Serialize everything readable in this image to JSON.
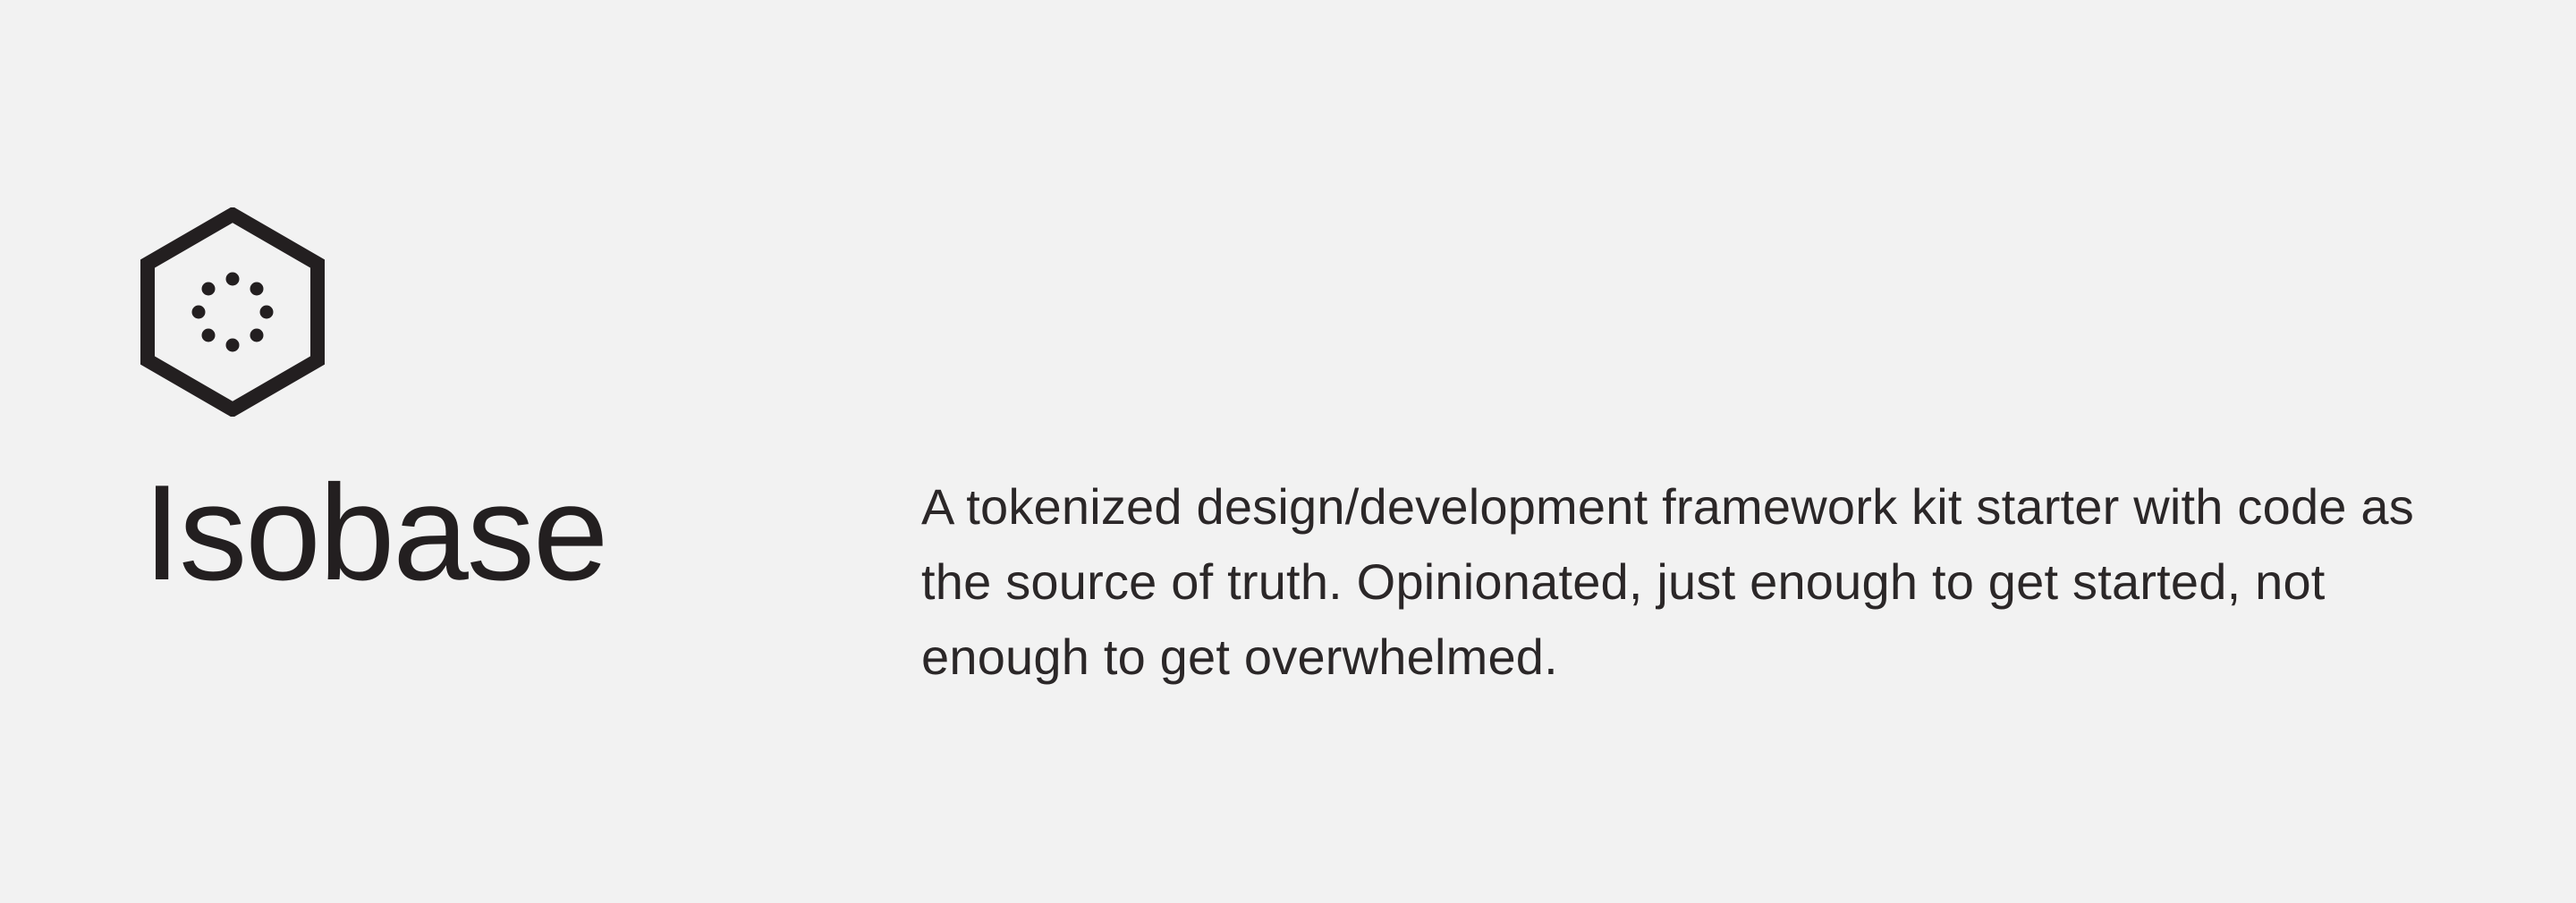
{
  "brand": {
    "name": "Isobase",
    "logo_icon": "hexagon-dots-icon",
    "color": "#231f20"
  },
  "description": {
    "text": "A tokenized design/development framework kit starter with code as the source of truth. Opinionated, just enough to get started, not enough to get overwhelmed."
  },
  "colors": {
    "background": "#f2f2f2",
    "text": "#231f20"
  }
}
